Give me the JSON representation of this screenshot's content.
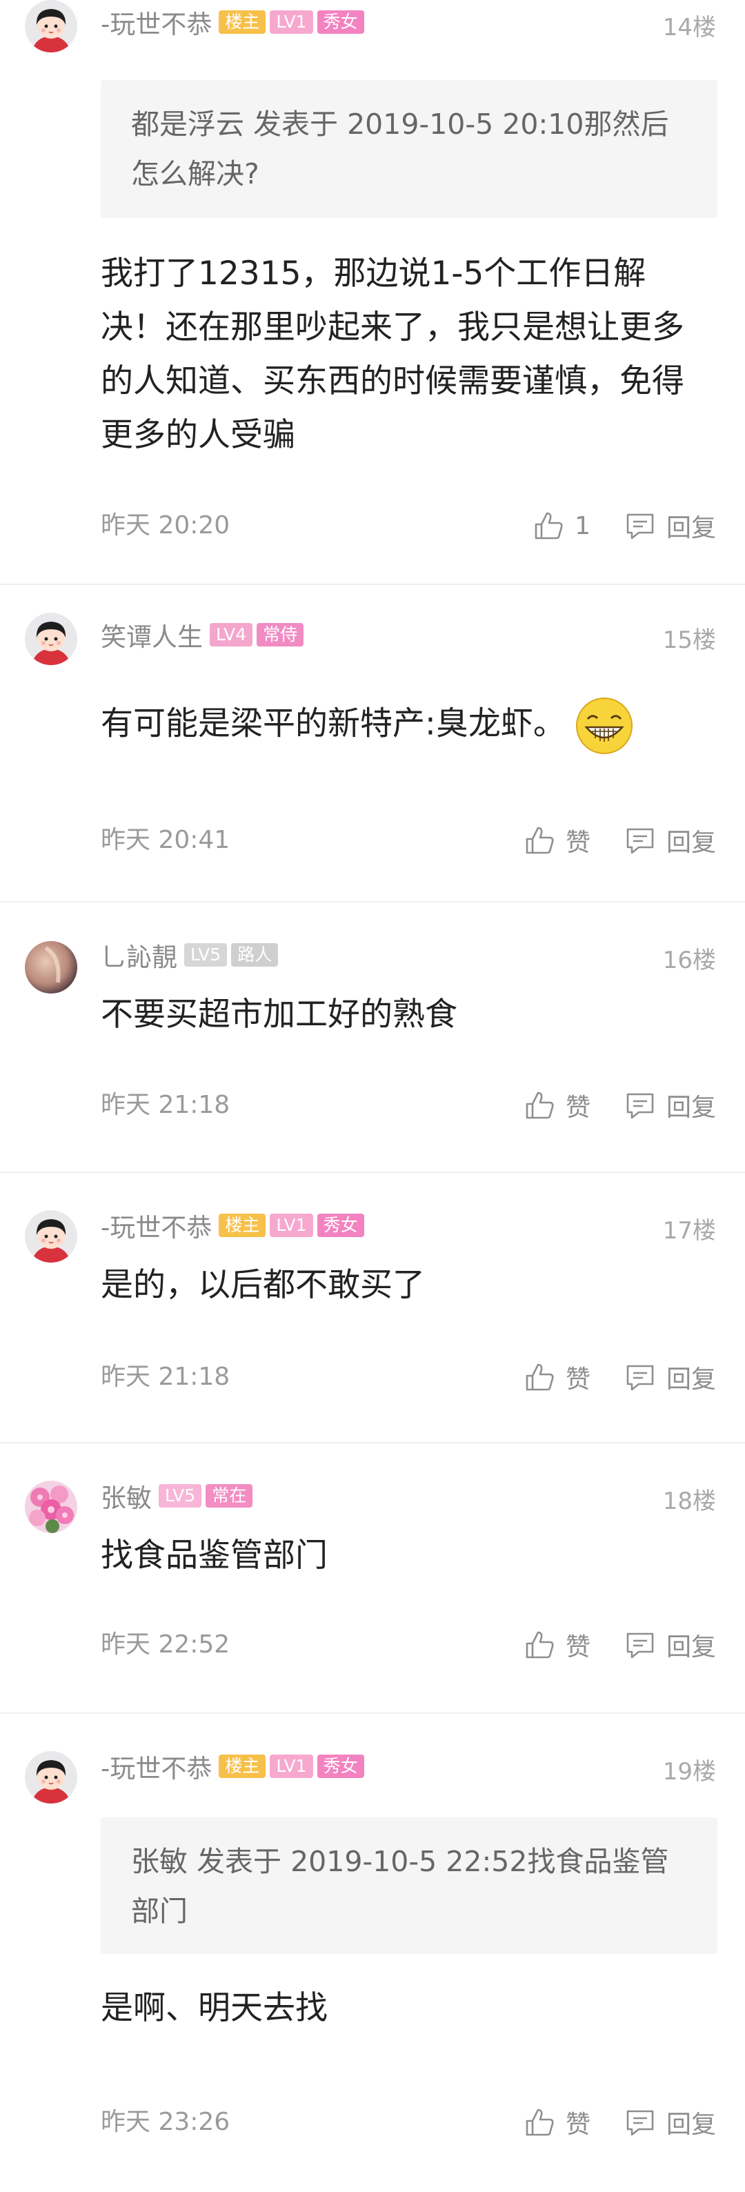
{
  "posts": [
    {
      "username": "-玩世不恭",
      "badges": [
        "楼主",
        "LV1",
        "秀女"
      ],
      "floor": "14楼",
      "quote": "都是浮云 发表于 2019-10-5 20:10那然后怎么解决?",
      "content": "我打了12315，那边说1-5个工作日解决！还在那里吵起来了，我只是想让更多的人知道、买东西的时候需要谨慎，免得更多的人受骗",
      "time": "昨天 20:20",
      "like_label": "1",
      "reply_label": "回复",
      "avatar": "cartoon-girl"
    },
    {
      "username": "笑谭人生",
      "badges": [
        "LV4",
        "常侍"
      ],
      "floor": "15楼",
      "content": "有可能是梁平的新特产:臭龙虾。",
      "emoji": "grin-emoji",
      "time": "昨天 20:41",
      "like_label": "赞",
      "reply_label": "回复",
      "avatar": "cartoon-girl"
    },
    {
      "username": "乚訫靚",
      "badges": [
        "LV5",
        "路人"
      ],
      "floor": "16楼",
      "content": "不要买超市加工好的熟食",
      "time": "昨天 21:18",
      "like_label": "赞",
      "reply_label": "回复",
      "avatar": "photo-skin"
    },
    {
      "username": "-玩世不恭",
      "badges": [
        "楼主",
        "LV1",
        "秀女"
      ],
      "floor": "17楼",
      "content": "是的，以后都不敢买了",
      "time": "昨天 21:18",
      "like_label": "赞",
      "reply_label": "回复",
      "avatar": "cartoon-girl"
    },
    {
      "username": "张敏",
      "badges": [
        "LV5",
        "常在"
      ],
      "floor": "18楼",
      "content": "找食品鉴管部门",
      "time": "昨天 22:52",
      "like_label": "赞",
      "reply_label": "回复",
      "avatar": "pink-flowers"
    },
    {
      "username": "-玩世不恭",
      "badges": [
        "楼主",
        "LV1",
        "秀女"
      ],
      "floor": "19楼",
      "quote": "张敏 发表于 2019-10-5 22:52找食品鉴管部门",
      "content": "是啊、明天去找",
      "time": "昨天 23:26",
      "like_label": "赞",
      "reply_label": "回复",
      "avatar": "cartoon-girl"
    }
  ]
}
